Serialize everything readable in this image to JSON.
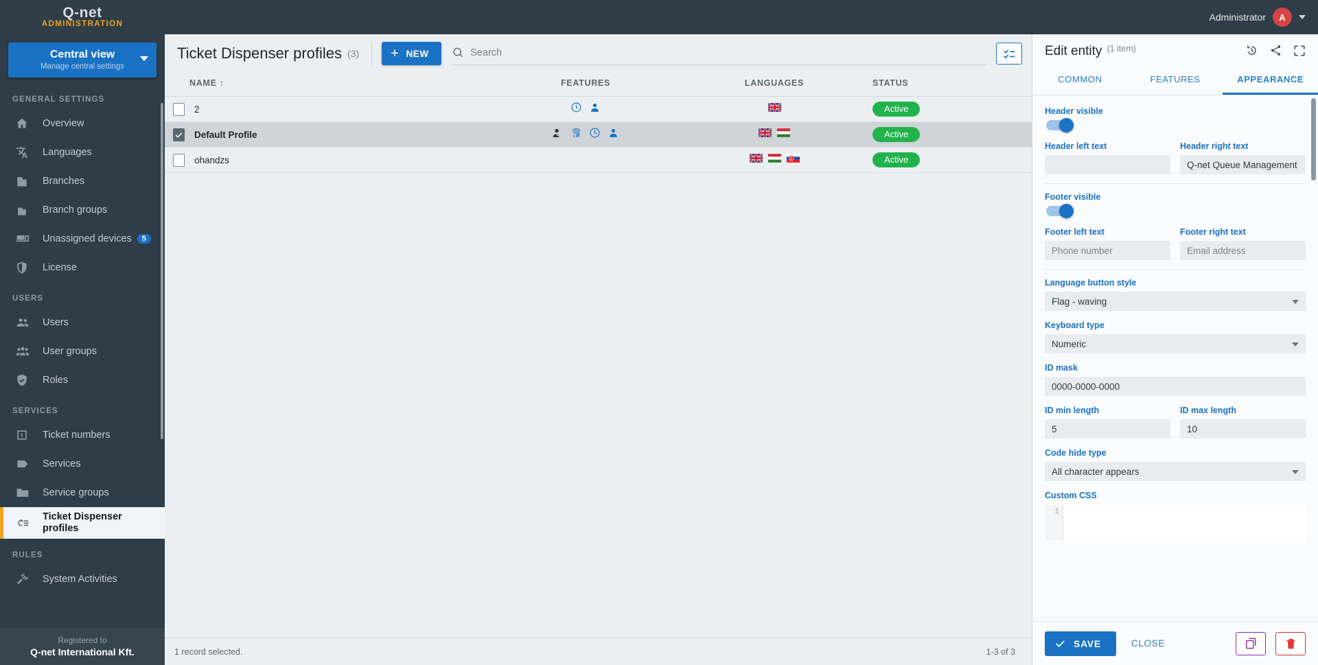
{
  "topbar": {
    "logo": "Q-net",
    "logo_sub": "ADMINISTRATION",
    "user_name": "Administrator",
    "avatar_letter": "A"
  },
  "sidebar": {
    "view_switch": {
      "title": "Central view",
      "subtitle": "Manage central settings"
    },
    "sections": [
      {
        "label": "GENERAL SETTINGS",
        "items": [
          {
            "label": "Overview",
            "icon": "home-icon",
            "badge": ""
          },
          {
            "label": "Languages",
            "icon": "translate-icon",
            "badge": ""
          },
          {
            "label": "Branches",
            "icon": "building-icon",
            "badge": ""
          },
          {
            "label": "Branch groups",
            "icon": "buildings-icon",
            "badge": ""
          },
          {
            "label": "Unassigned devices",
            "icon": "devices-icon",
            "badge": "5"
          },
          {
            "label": "License",
            "icon": "shield-icon",
            "badge": ""
          }
        ]
      },
      {
        "label": "USERS",
        "items": [
          {
            "label": "Users",
            "icon": "users-icon",
            "badge": ""
          },
          {
            "label": "User groups",
            "icon": "user-group-icon",
            "badge": ""
          },
          {
            "label": "Roles",
            "icon": "shield-check-icon",
            "badge": ""
          }
        ]
      },
      {
        "label": "SERVICES",
        "items": [
          {
            "label": "Ticket numbers",
            "icon": "number-one-icon",
            "badge": ""
          },
          {
            "label": "Services",
            "icon": "tag-icon",
            "badge": ""
          },
          {
            "label": "Service groups",
            "icon": "folder-icon",
            "badge": ""
          },
          {
            "label": "Ticket Dispenser profiles",
            "icon": "dispenser-icon",
            "badge": "",
            "active": true
          }
        ]
      },
      {
        "label": "RULES",
        "items": [
          {
            "label": "System Activities",
            "icon": "gavel-icon",
            "badge": ""
          }
        ]
      }
    ],
    "registered_label": "Registered to",
    "registered_name": "Q-net International Kft."
  },
  "main": {
    "title": "Ticket Dispenser profiles",
    "count": "(3)",
    "new_button": "NEW",
    "search_placeholder": "Search",
    "search_value": "",
    "columns": {
      "name": "NAME",
      "sort_arrow": "↑",
      "features": "FEATURES",
      "languages": "LANGUAGES",
      "status": "STATUS"
    },
    "rows": [
      {
        "name": "2",
        "selected": false,
        "bold": false,
        "features": [
          "clock-icon",
          "person-icon"
        ],
        "languages": [
          "uk"
        ],
        "status": "Active"
      },
      {
        "name": "Default Profile",
        "selected": true,
        "bold": true,
        "features": [
          "person-check-icon",
          "fingerprint-icon",
          "clock-icon",
          "person-icon"
        ],
        "languages": [
          "uk",
          "hu"
        ],
        "status": "Active"
      },
      {
        "name": "ohandzs",
        "selected": false,
        "bold": false,
        "features": [],
        "languages": [
          "uk",
          "hu",
          "sk"
        ],
        "status": "Active"
      }
    ],
    "footer_left": "1 record selected.",
    "footer_right": "1-3 of 3"
  },
  "panel": {
    "title": "Edit entity",
    "count": "(1 item)",
    "head_icons": [
      "history-icon",
      "share-icon",
      "fullscreen-icon"
    ],
    "tabs": [
      {
        "label": "COMMON",
        "active": false
      },
      {
        "label": "FEATURES",
        "active": false
      },
      {
        "label": "APPEARANCE",
        "active": true
      }
    ],
    "fields": {
      "header_visible_label": "Header visible",
      "header_visible_on": true,
      "header_left_label": "Header left text",
      "header_left_value": "",
      "header_left_placeholder": "",
      "header_right_label": "Header right text",
      "header_right_value": "Q-net Queue Management Sys",
      "footer_visible_label": "Footer visible",
      "footer_visible_on": true,
      "footer_left_label": "Footer left text",
      "footer_left_value": "",
      "footer_left_placeholder": "Phone number",
      "footer_right_label": "Footer right text",
      "footer_right_value": "",
      "footer_right_placeholder": "Email address",
      "language_button_style_label": "Language button style",
      "language_button_style_value": "Flag - waving",
      "keyboard_type_label": "Keyboard type",
      "keyboard_type_value": "Numeric",
      "id_mask_label": "ID mask",
      "id_mask_value": "0000-0000-0000",
      "id_min_label": "ID min length",
      "id_min_value": "5",
      "id_max_label": "ID max length",
      "id_max_value": "10",
      "code_hide_label": "Code hide type",
      "code_hide_value": "All character appears",
      "custom_css_label": "Custom CSS",
      "custom_css_line_no": "1",
      "custom_css_value": ""
    },
    "footer": {
      "save_label": "SAVE",
      "close_label": "CLOSE",
      "copy_icon": "copy-icon",
      "delete_icon": "trash-icon"
    }
  },
  "colors": {
    "accent_blue": "#1a72c4",
    "sidebar_bg": "#2e3d48",
    "active_orange": "#f5a01e",
    "status_green": "#22b24c",
    "delete_red": "#d32f2f",
    "copy_purple": "#8e2fa8"
  }
}
